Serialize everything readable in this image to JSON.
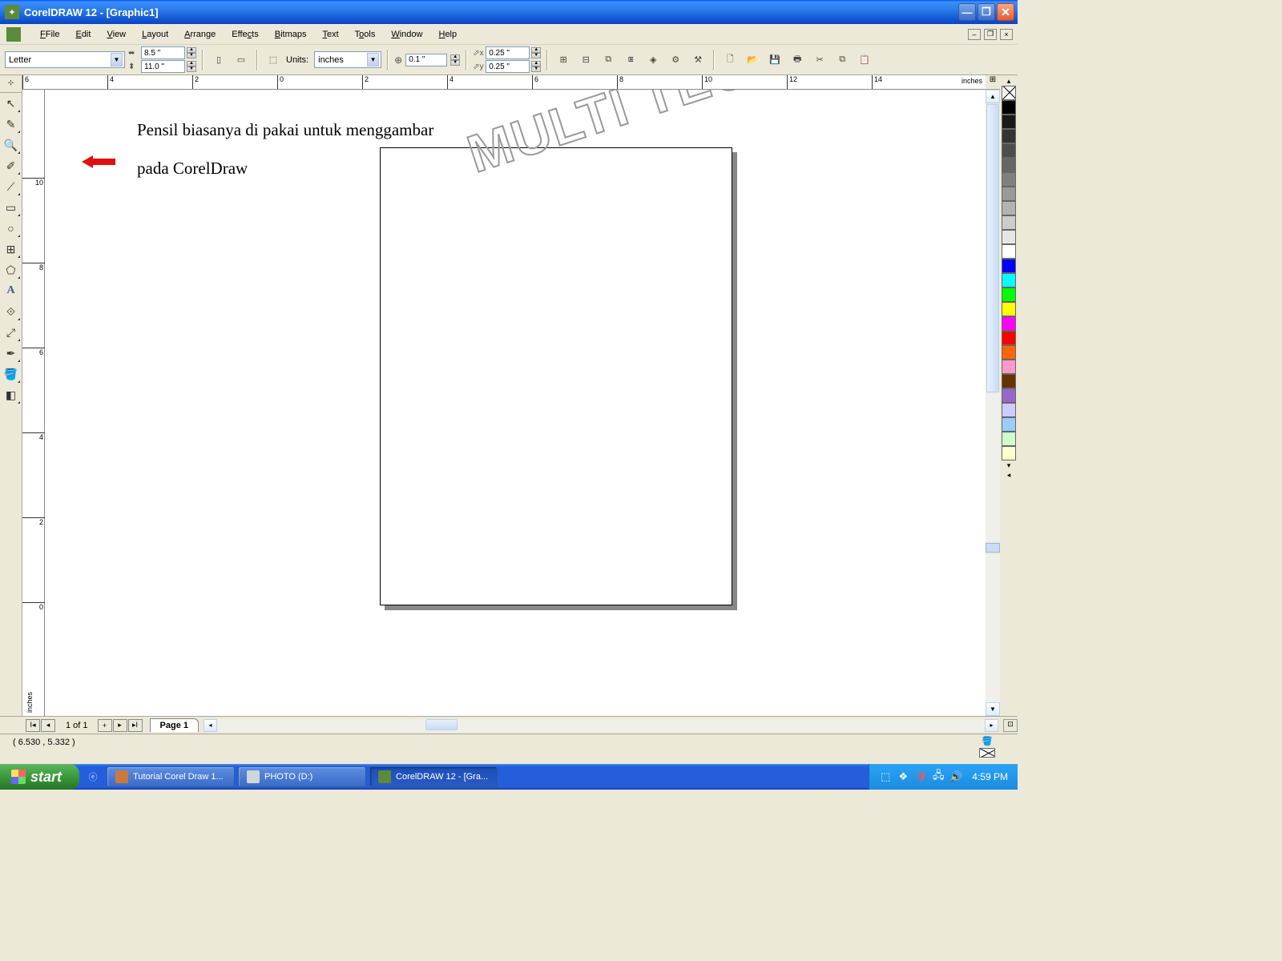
{
  "titlebar": {
    "app_title": "CorelDRAW 12 - [Graphic1]"
  },
  "menus": [
    "File",
    "Edit",
    "View",
    "Layout",
    "Arrange",
    "Effects",
    "Bitmaps",
    "Text",
    "Tools",
    "Window",
    "Help"
  ],
  "propbar": {
    "paper": "Letter",
    "width": "8.5 \"",
    "height": "11.0 \"",
    "units_label": "Units:",
    "units_value": "inches",
    "nudge": "0.1 \"",
    "dup_x": "0.25 \"",
    "dup_y": "0.25 \""
  },
  "ruler_unit": "inches",
  "hruler_ticks": [
    "6",
    "4",
    "2",
    "0",
    "2",
    "4",
    "6",
    "8",
    "10",
    "12",
    "14"
  ],
  "vruler_ticks": [
    "10",
    "8",
    "6",
    "4",
    "2",
    "0"
  ],
  "annotation": {
    "line1": "Pensil biasanya di pakai untuk menggambar",
    "line2": "pada CorelDraw"
  },
  "watermark": "MULTI TECH",
  "page_nav": {
    "counter": "1 of 1",
    "tab": "Page 1"
  },
  "statusbar": {
    "coords": "( 6.530 , 5.332 )"
  },
  "palette": [
    "#000000",
    "#1a1a1a",
    "#333333",
    "#4d4d4d",
    "#666666",
    "#808080",
    "#999999",
    "#b3b3b3",
    "#cccccc",
    "#e6e6e6",
    "#ffffff",
    "#0000ff",
    "#00ffff",
    "#00ff00",
    "#ffff00",
    "#ff00ff",
    "#ff0000",
    "#ff6600",
    "#ff99cc",
    "#663300",
    "#9966cc",
    "#ccccff",
    "#99ccff",
    "#ccffcc",
    "#ffffcc"
  ],
  "taskbar": {
    "start": "start",
    "items": [
      {
        "label": "Tutorial Corel Draw 1...",
        "icon_color": "#c97a3a"
      },
      {
        "label": "PHOTO (D:)",
        "icon_color": "#cfd6da"
      },
      {
        "label": "CorelDRAW 12 - [Gra...",
        "icon_color": "#5a8a3a"
      }
    ],
    "clock": "4:59 PM"
  }
}
